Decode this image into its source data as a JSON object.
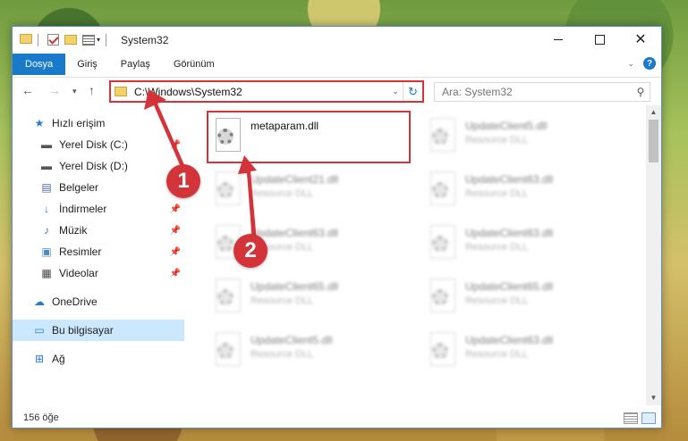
{
  "window": {
    "title": "System32"
  },
  "ribbon": {
    "tabs": [
      "Dosya",
      "Giriş",
      "Paylaş",
      "Görünüm"
    ]
  },
  "address": {
    "path": "C:\\Windows\\System32"
  },
  "search": {
    "placeholder": "Ara: System32"
  },
  "sidebar": {
    "items": [
      {
        "label": "Hızlı erişim",
        "icon": "star-icon"
      },
      {
        "label": "Yerel Disk (C:)",
        "icon": "drive-icon",
        "pinned": true
      },
      {
        "label": "Yerel Disk (D:)",
        "icon": "drive-icon"
      },
      {
        "label": "Belgeler",
        "icon": "documents-icon",
        "pinned": true
      },
      {
        "label": "İndirmeler",
        "icon": "download-icon",
        "pinned": true
      },
      {
        "label": "Müzik",
        "icon": "music-icon",
        "pinned": true
      },
      {
        "label": "Resimler",
        "icon": "pictures-icon",
        "pinned": true
      },
      {
        "label": "Videolar",
        "icon": "videos-icon",
        "pinned": true
      },
      {
        "label": "OneDrive",
        "icon": "cloud-icon"
      },
      {
        "label": "Bu bilgisayar",
        "icon": "computer-icon",
        "selected": true
      },
      {
        "label": "Ağ",
        "icon": "network-icon"
      }
    ]
  },
  "files": [
    {
      "name": "metaparam.dll",
      "type": ""
    },
    {
      "name": "UpdateClient5.dll",
      "type": "Resource DLL"
    },
    {
      "name": "UpdateClient21.dll",
      "type": "Resource DLL"
    },
    {
      "name": "UpdateClient63.dll",
      "type": "Resource DLL"
    },
    {
      "name": "UpdateClient63.dll",
      "type": "Resource DLL"
    },
    {
      "name": "UpdateClient63.dll",
      "type": "Resource DLL"
    },
    {
      "name": "UpdateClient65.dll",
      "type": "Resource DLL"
    },
    {
      "name": "UpdateClient65.dll",
      "type": "Resource DLL"
    },
    {
      "name": "UpdateClient5.dll",
      "type": "Resource DLL"
    },
    {
      "name": "UpdateClient63.dll",
      "type": "Resource DLL"
    }
  ],
  "status": {
    "count": "156 öğe"
  },
  "annotations": {
    "badge1": "1",
    "badge2": "2"
  },
  "colors": {
    "accent": "#1979ca",
    "highlight": "#d2343a"
  }
}
